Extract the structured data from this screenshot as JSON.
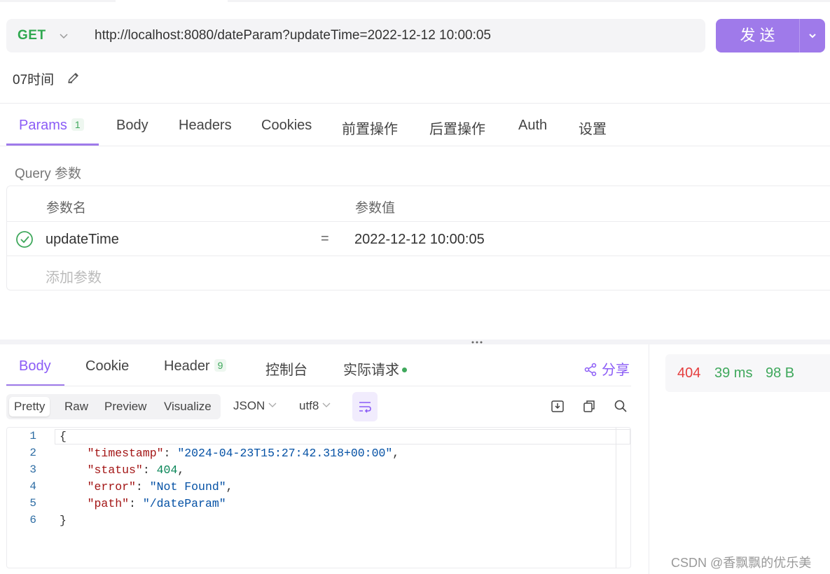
{
  "request": {
    "method": "GET",
    "url": "http://localhost:8080/dateParam?updateTime=2022-12-12 10:00:05",
    "send_label": "发送",
    "name": "07时间"
  },
  "tabs": [
    {
      "label": "Params",
      "badge": "1"
    },
    {
      "label": "Body"
    },
    {
      "label": "Headers"
    },
    {
      "label": "Cookies"
    },
    {
      "label": "前置操作"
    },
    {
      "label": "后置操作"
    },
    {
      "label": "Auth"
    },
    {
      "label": "设置"
    }
  ],
  "query": {
    "section_label": "Query 参数",
    "col_name": "参数名",
    "col_value": "参数值",
    "rows": [
      {
        "key": "updateTime",
        "eq": "=",
        "value": "2022-12-12 10:00:05"
      }
    ],
    "add_placeholder": "添加参数"
  },
  "response": {
    "tabs": [
      {
        "label": "Body"
      },
      {
        "label": "Cookie"
      },
      {
        "label": "Header",
        "badge": "9"
      },
      {
        "label": "控制台"
      },
      {
        "label": "实际请求"
      }
    ],
    "share_label": "分享",
    "status": "404",
    "time": "39 ms",
    "size": "98 B",
    "view_modes": [
      "Pretty",
      "Raw",
      "Preview",
      "Visualize"
    ],
    "format": "JSON",
    "encoding": "utf8",
    "line_numbers": [
      "1",
      "2",
      "3",
      "4",
      "5",
      "6"
    ],
    "json": {
      "open": "{",
      "close": "}",
      "k_timestamp": "\"timestamp\"",
      "v_timestamp": "\"2024-04-23T15:27:42.318+00:00\"",
      "k_status": "\"status\"",
      "v_status": "404",
      "k_error": "\"error\"",
      "v_error": "\"Not Found\"",
      "k_path": "\"path\"",
      "v_path": "\"/dateParam\""
    }
  },
  "watermark": "CSDN @香飘飘的优乐美",
  "colors": {
    "accent": "#9f7aea",
    "method_get": "#2fa84f",
    "status_error": "#e53e3e",
    "ok_green": "#3fa85c"
  }
}
